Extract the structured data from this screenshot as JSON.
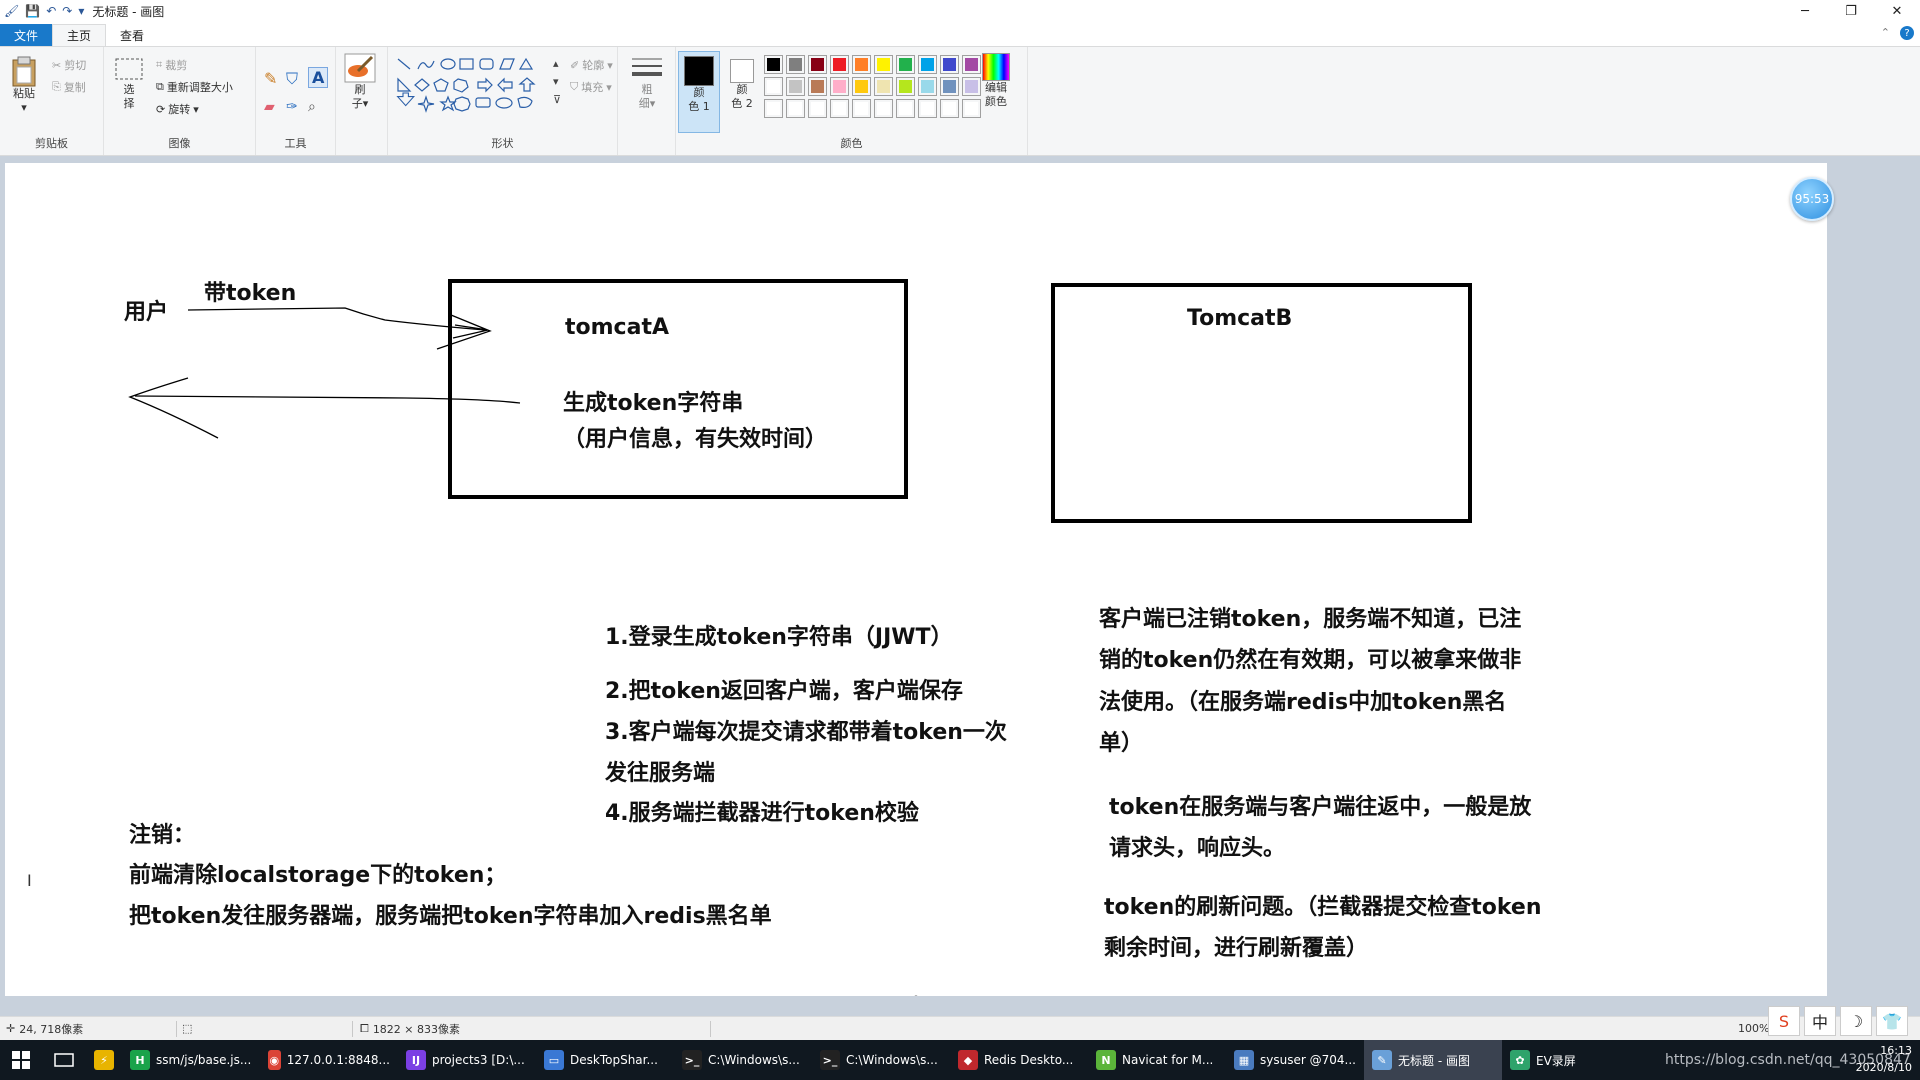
{
  "window": {
    "title": "无标题 - 画图",
    "controls": [
      "─",
      "❐",
      "✕"
    ]
  },
  "tabs": {
    "file": "文件",
    "home": "主页",
    "view": "查看"
  },
  "ribbon": {
    "clipboard": {
      "group": "剪贴板",
      "paste": "粘贴",
      "cut": "剪切",
      "copy": "复制"
    },
    "image": {
      "group": "图像",
      "select": "选",
      "select2": "择",
      "crop": "裁剪",
      "resize": "重新调整大小",
      "rotate": "旋转"
    },
    "tools": {
      "group": "工具"
    },
    "brushes": {
      "label1": "刷",
      "label2": "子"
    },
    "shapes": {
      "group": "形状",
      "outline": "轮廓",
      "fill": "填充"
    },
    "size": {
      "label1": "粗",
      "label2": "细"
    },
    "colors": {
      "group": "颜色",
      "color1_a": "颜",
      "color1_b": "色 1",
      "color2_a": "颜",
      "color2_b": "色 2",
      "edit_a": "编辑",
      "edit_b": "颜色",
      "color1": "#000000",
      "color2": "#ffffff",
      "palette_row1": [
        "#000000",
        "#7f7f7f",
        "#880015",
        "#ed1c24",
        "#ff7f27",
        "#fff200",
        "#22b14c",
        "#00a2e8",
        "#3f48cc",
        "#a349a4"
      ],
      "palette_row2": [
        "#ffffff",
        "#c3c3c3",
        "#b97a57",
        "#ffaec9",
        "#ffc90e",
        "#efe4b0",
        "#b5e61d",
        "#99d9ea",
        "#7092be",
        "#c8bfe7"
      ],
      "palette_row3": [
        "#ffffff",
        "#ffffff",
        "#ffffff",
        "#ffffff",
        "#ffffff",
        "#ffffff",
        "#ffffff",
        "#ffffff",
        "#ffffff",
        "#ffffff"
      ]
    }
  },
  "canvas": {
    "user": "用户",
    "with_token": "带token",
    "tomcatA": "tomcatA",
    "gen_token": "生成token字符串",
    "gen_token_detail": "（用户信息，有失效时间）",
    "tomcatB": "TomcatB",
    "steps": [
      "1.登录生成token字符串（JJWT）",
      "2.把token返回客户端，客户端保存",
      "3.客户端每次提交请求都带着token一次",
      "发往服务端",
      "4.服务端拦截器进行token校验"
    ],
    "logout_title": "注销：",
    "logout_lines": [
      "前端清除localstorage下的token；",
      "把token发往服务器端，服务端把token字符串加入redis黑名单"
    ],
    "note1": [
      "客户端已注销token，服务端不知道，已注",
      "销的token仍然在有效期，可以被拿来做非",
      "法使用。（在服务端redis中加token黑名",
      "单）"
    ],
    "note2": [
      "token在服务端与客户端往返中，一般是放",
      "请求头，响应头。"
    ],
    "note3": [
      "token的刷新问题。（拦截器提交检查token",
      "剩余时间，进行刷新覆盖）"
    ]
  },
  "timer": "95:53",
  "status": {
    "cursor_pos": "24, 718像素",
    "canvas_size": "1822 × 833像素",
    "zoom": "100%"
  },
  "tray_icons": [
    "S",
    "中",
    "☽",
    "👕"
  ],
  "taskbar": {
    "items": [
      {
        "label": "",
        "color": "#e8b400",
        "icon": "⚡"
      },
      {
        "label": "ssm/js/base.js...",
        "color": "#1aa34a",
        "icon": "H"
      },
      {
        "label": "127.0.0.1:8848...",
        "color": "#db4437",
        "icon": "◉"
      },
      {
        "label": "projects3 [D:\\...",
        "color": "#7b3fe4",
        "icon": "IJ"
      },
      {
        "label": "DeskTopShar...",
        "color": "#3a78d4",
        "icon": "▭"
      },
      {
        "label": "C:\\Windows\\s...",
        "color": "#222222",
        "icon": ">_"
      },
      {
        "label": "C:\\Windows\\s...",
        "color": "#222222",
        "icon": ">_"
      },
      {
        "label": "Redis Deskto...",
        "color": "#c0282d",
        "icon": "◆"
      },
      {
        "label": "Navicat for M...",
        "color": "#5bb43a",
        "icon": "N"
      },
      {
        "label": "sysuser @704...",
        "color": "#4a7bbf",
        "icon": "▦"
      },
      {
        "label": "无标题 - 画图",
        "color": "#6aa0d8",
        "icon": "✎"
      },
      {
        "label": "EV录屏",
        "color": "#2ea36b",
        "icon": "✿"
      }
    ],
    "watermark": "https://blog.csdn.net/qq_43050847",
    "time": "16:13",
    "date": "2020/8/10"
  }
}
